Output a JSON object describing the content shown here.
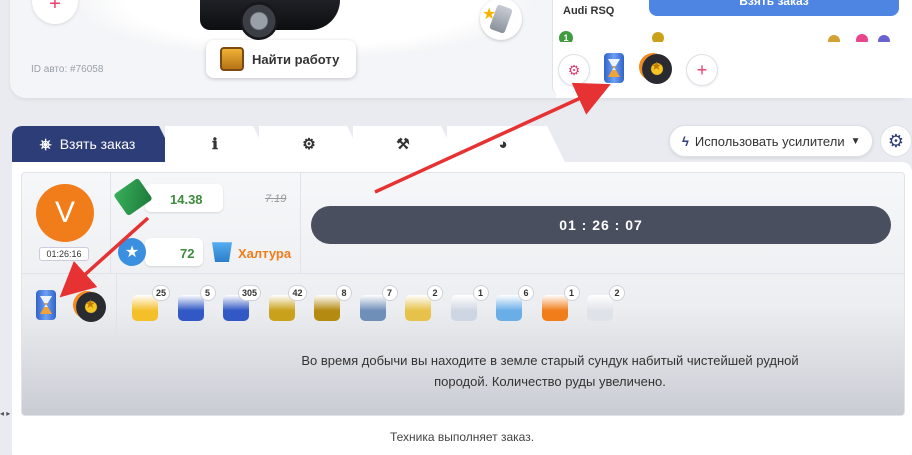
{
  "car": {
    "id_label": "ID авто: #76058",
    "find_job_label": "Найти работу",
    "add_label": "+"
  },
  "right_panel": {
    "car_name": "Audi RSQ",
    "take_order_label": "Взять заказ",
    "level": "1",
    "boost_add_label": "+"
  },
  "tabs": [
    {
      "label": "Взять заказ",
      "icon": "steering-wheel-icon"
    },
    {
      "label": "",
      "icon": "info-icon"
    },
    {
      "label": "",
      "icon": "engine-icon"
    },
    {
      "label": "",
      "icon": "tools-icon"
    },
    {
      "label": "",
      "icon": "speedometer-icon"
    }
  ],
  "boosters_dropdown": {
    "label": "Использовать усилители",
    "icon": "lightning-icon"
  },
  "driver": {
    "avatar_letter": "V",
    "timer": "01:26:16"
  },
  "stats": {
    "money": "14.38",
    "money_old": "7.19",
    "rating": "72",
    "quality": "Халтура"
  },
  "order_timer": "01 : 26 : 07",
  "items": [
    {
      "name": "water-ski-item",
      "count": "25",
      "color": "#f4c02a"
    },
    {
      "name": "fuel-canister-item",
      "count": "5",
      "color": "#3158c4"
    },
    {
      "name": "fuel-cans-item",
      "count": "305",
      "color": "#3158c4"
    },
    {
      "name": "golden-gear-item",
      "count": "42",
      "color": "#c9a11a"
    },
    {
      "name": "golden-medal-item",
      "count": "8",
      "color": "#b58a10"
    },
    {
      "name": "wrench-item",
      "count": "7",
      "color": "#6f8fb8"
    },
    {
      "name": "jar-item",
      "count": "2",
      "color": "#e6c24a"
    },
    {
      "name": "oil-jar-item",
      "count": "1",
      "color": "#cfd6e3"
    },
    {
      "name": "pencil-item",
      "count": "6",
      "color": "#6aaee8"
    },
    {
      "name": "orange-orb-item",
      "count": "1",
      "color": "#f07d1a"
    },
    {
      "name": "glass-jar-item",
      "count": "2",
      "color": "#dfe3e9"
    }
  ],
  "description": "Во время добычи вы находите в земле старый сундук набитый чистейшей рудной породой. Количество руды увеличено.",
  "status": "Техника выполняет заказ.",
  "side_mark": "◂ ▸"
}
